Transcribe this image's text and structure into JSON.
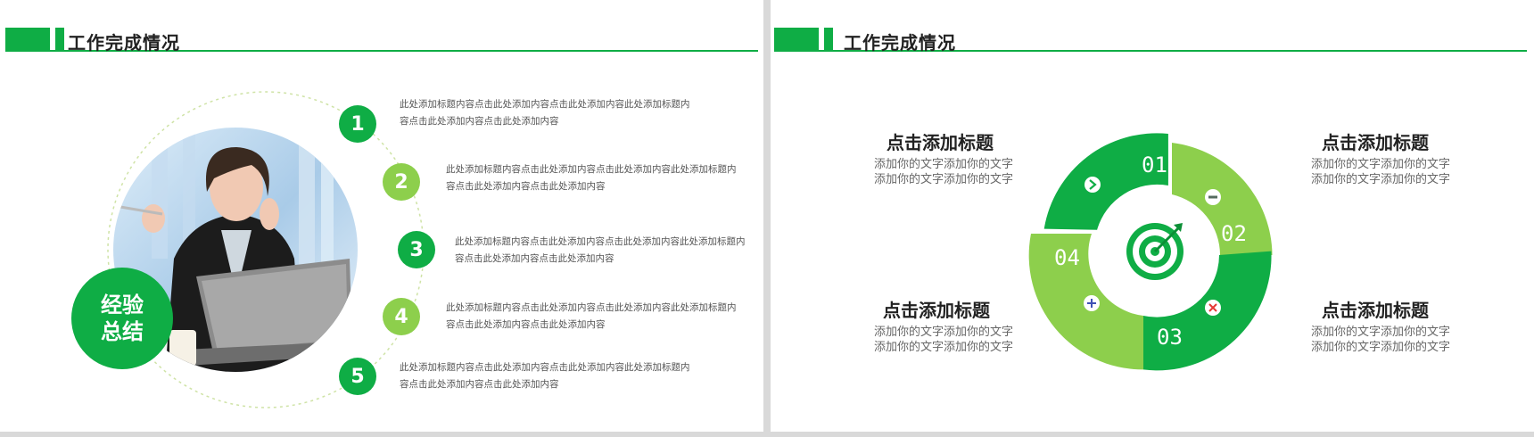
{
  "colors": {
    "primary": "#0fad45",
    "secondary": "#8dcf4c",
    "dark": "#0b8f36",
    "dotted": "#cfe3a6"
  },
  "left_slide": {
    "header": {
      "title": "工作完成情况"
    },
    "badge": {
      "line1": "经验",
      "line2": "总结"
    },
    "photo": {
      "subject": "businesswoman-with-laptop-and-phone"
    },
    "items": [
      {
        "number": "1",
        "text": "此处添加标题内容点击此处添加内容点击此处添加内容此处添加标题内容点击此处添加内容点击此处添加内容"
      },
      {
        "number": "2",
        "text": "此处添加标题内容点击此处添加内容点击此处添加内容此处添加标题内容点击此处添加内容点击此处添加内容"
      },
      {
        "number": "3",
        "text": "此处添加标题内容点击此处添加内容点击此处添加内容此处添加标题内容点击此处添加内容点击此处添加内容"
      },
      {
        "number": "4",
        "text": "此处添加标题内容点击此处添加内容点击此处添加内容此处添加标题内容点击此处添加内容点击此处添加内容"
      },
      {
        "number": "5",
        "text": "此处添加标题内容点击此处添加内容点击此处添加内容此处添加标题内容点击此处添加内容点击此处添加内容"
      }
    ]
  },
  "right_slide": {
    "header": {
      "title": "工作完成情况"
    },
    "quadrants": [
      {
        "title": "点击添加标题",
        "body": "添加你的文字添加你的文字添加你的文字添加你的文字"
      },
      {
        "title": "点击添加标题",
        "body": "添加你的文字添加你的文字添加你的文字添加你的文字"
      },
      {
        "title": "点击添加标题",
        "body": "添加你的文字添加你的文字添加你的文字添加你的文字"
      },
      {
        "title": "点击添加标题",
        "body": "添加你的文字添加你的文字添加你的文字添加你的文字"
      }
    ],
    "wheel": {
      "labels": [
        "01",
        "02",
        "03",
        "04"
      ],
      "icons": [
        "arrow-right-icon",
        "minus-icon",
        "close-icon",
        "plus-icon"
      ],
      "center_icon": "target-icon"
    }
  }
}
